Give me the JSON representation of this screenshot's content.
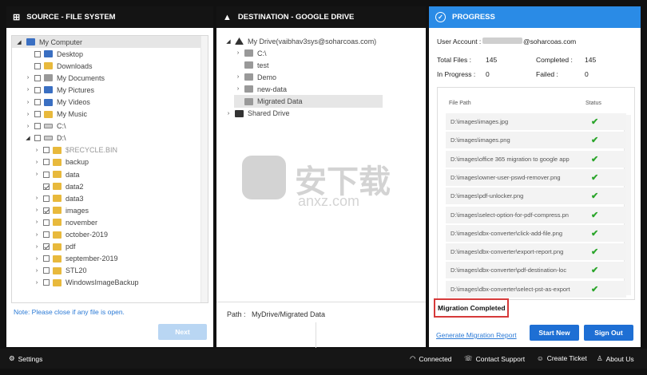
{
  "source": {
    "title": "SOURCE - FILE SYSTEM",
    "note": "Note: Please close if any file is open.",
    "next": "Next",
    "tree": [
      {
        "label": "My Computer",
        "arrow": "◢",
        "cb": false,
        "icon": "computer",
        "indent": 0,
        "sel": true
      },
      {
        "label": "Desktop",
        "arrow": "",
        "cb": true,
        "icon": "blue",
        "indent": 1
      },
      {
        "label": "Downloads",
        "arrow": "",
        "cb": true,
        "icon": "folder",
        "indent": 1
      },
      {
        "label": "My Documents",
        "arrow": "›",
        "cb": true,
        "icon": "gfolder",
        "indent": 1
      },
      {
        "label": "My Pictures",
        "arrow": "›",
        "cb": true,
        "icon": "blue",
        "indent": 1
      },
      {
        "label": "My Videos",
        "arrow": "›",
        "cb": true,
        "icon": "blue",
        "indent": 1
      },
      {
        "label": "My Music",
        "arrow": "›",
        "cb": true,
        "icon": "folder",
        "indent": 1
      },
      {
        "label": "C:\\",
        "arrow": "›",
        "cb": true,
        "icon": "drive",
        "indent": 1
      },
      {
        "label": "D:\\",
        "arrow": "◢",
        "cb": true,
        "icon": "drive",
        "indent": 1
      },
      {
        "label": "$RECYCLE.BIN",
        "arrow": "›",
        "cb": true,
        "icon": "folder",
        "indent": 2,
        "dim": true
      },
      {
        "label": "backup",
        "arrow": "›",
        "cb": true,
        "icon": "folder",
        "indent": 2
      },
      {
        "label": "data",
        "arrow": "›",
        "cb": true,
        "icon": "folder",
        "indent": 2
      },
      {
        "label": "data2",
        "arrow": "",
        "cb": true,
        "chk": true,
        "icon": "folder",
        "indent": 2
      },
      {
        "label": "data3",
        "arrow": "›",
        "cb": true,
        "icon": "folder",
        "indent": 2
      },
      {
        "label": "images",
        "arrow": "›",
        "cb": true,
        "chk": true,
        "icon": "folder",
        "indent": 2
      },
      {
        "label": "november",
        "arrow": "›",
        "cb": true,
        "icon": "folder",
        "indent": 2
      },
      {
        "label": "october-2019",
        "arrow": "›",
        "cb": true,
        "icon": "folder",
        "indent": 2
      },
      {
        "label": "pdf",
        "arrow": "›",
        "cb": true,
        "chk": true,
        "icon": "folder",
        "indent": 2
      },
      {
        "label": "september-2019",
        "arrow": "›",
        "cb": true,
        "icon": "folder",
        "indent": 2
      },
      {
        "label": "STL20",
        "arrow": "›",
        "cb": true,
        "icon": "folder",
        "indent": 2
      },
      {
        "label": "WindowsImageBackup",
        "arrow": "›",
        "cb": true,
        "icon": "folder",
        "indent": 2
      }
    ]
  },
  "destination": {
    "title": "DESTINATION - GOOGLE DRIVE",
    "path_label": "Path :",
    "path_value": "MyDrive/Migrated Data",
    "tree": [
      {
        "label": "My Drive(vaibhav3sys@soharcoas.com)",
        "arrow": "◢",
        "icon": "drive-logo",
        "indent": 0
      },
      {
        "label": "C:\\",
        "arrow": "›",
        "icon": "gfolder",
        "indent": 1
      },
      {
        "label": "test",
        "arrow": "",
        "icon": "gfolder",
        "indent": 1
      },
      {
        "label": "Demo",
        "arrow": "›",
        "icon": "gfolder",
        "indent": 1
      },
      {
        "label": "new-data",
        "arrow": "›",
        "icon": "gfolder",
        "indent": 1
      },
      {
        "label": "Migrated Data",
        "arrow": "",
        "icon": "gfolder",
        "indent": 1,
        "sel": true
      },
      {
        "label": "Shared Drive",
        "arrow": "›",
        "icon": "shared",
        "indent": 0
      }
    ]
  },
  "progress": {
    "title": "PROGRESS",
    "account_label": "User Account :",
    "account_value": "@soharcoas.com",
    "total_label": "Total Files :",
    "total_value": "145",
    "completed_label": "Completed :",
    "completed_value": "145",
    "inprogress_label": "In Progress :",
    "inprogress_value": "0",
    "failed_label": "Failed :",
    "failed_value": "0",
    "col_path": "File Path",
    "col_status": "Status",
    "files": [
      "D:\\images\\images.jpg",
      "D:\\images\\images.png",
      "D:\\images\\office 365 migration to google app",
      "D:\\images\\owner-user-pswd-remover.png",
      "D:\\images\\pdf-unlocker.png",
      "D:\\images\\select-option-for-pdf-compress.pn",
      "D:\\images\\dbx-converter\\click-add-file.png",
      "D:\\images\\dbx-converter\\export-report.png",
      "D:\\images\\dbx-converter\\pdf-destination-loc",
      "D:\\images\\dbx-converter\\select-pst-as-export"
    ],
    "status_text": "Migration Completed",
    "report_link": "Generate Migration Report",
    "start_new": "Start New",
    "sign_out": "Sign Out",
    "accent": "#2a8be6"
  },
  "footer": {
    "settings": "Settings",
    "connected": "Connected",
    "contact": "Contact Support",
    "ticket": "Create Ticket",
    "about": "About Us"
  }
}
